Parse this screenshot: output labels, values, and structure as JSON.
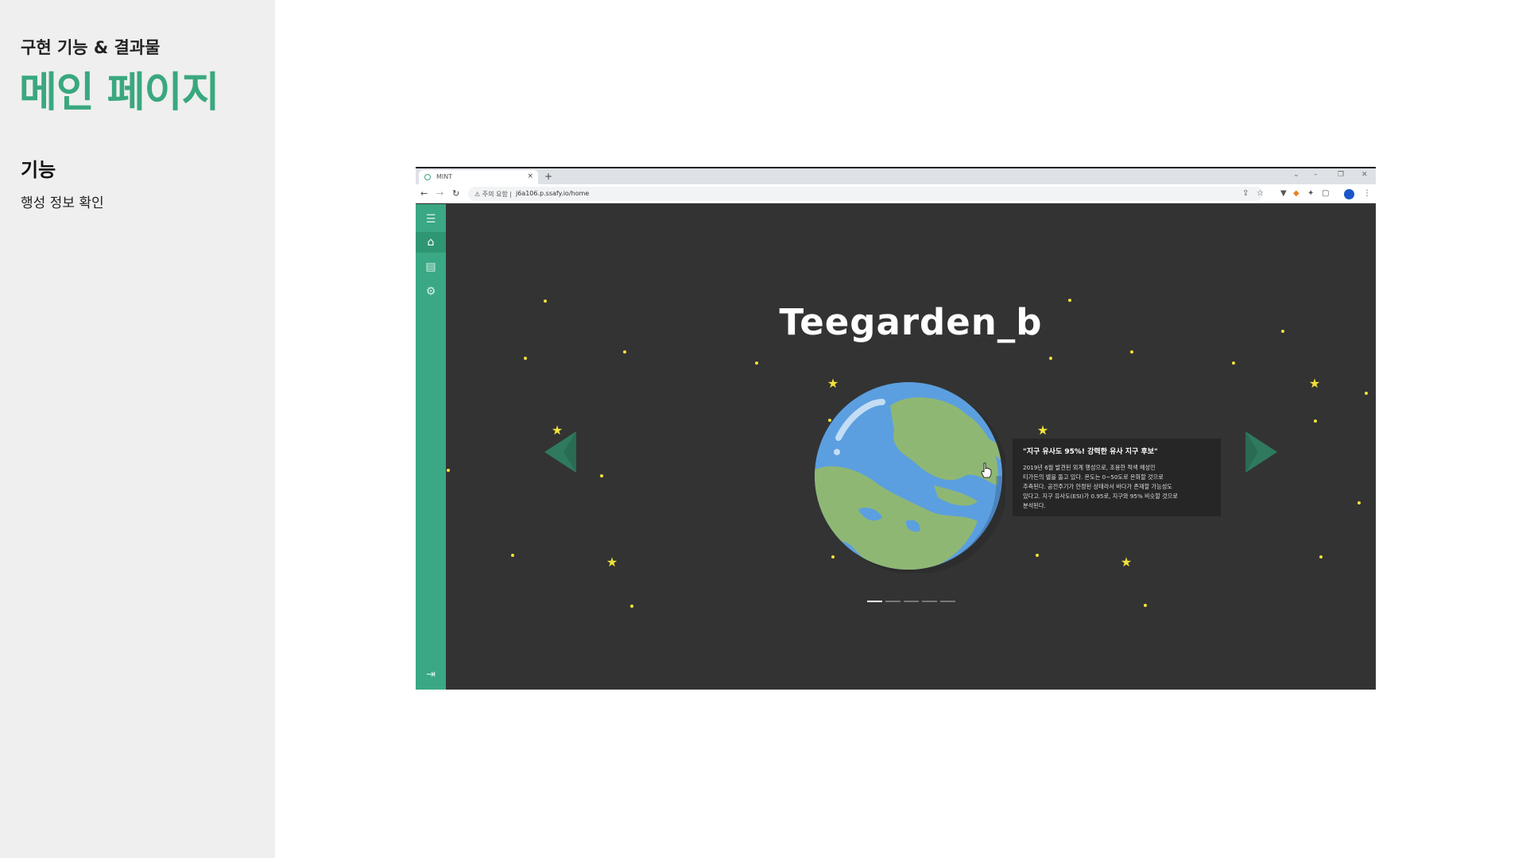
{
  "slide": {
    "subtitle": "구현 기능 & 결과물",
    "title": "메인 페이지",
    "feature_heading": "기능",
    "feature_desc": "행성 정보 확인"
  },
  "browser": {
    "tab_title": "MINT",
    "tab_close": "×",
    "new_tab": "+",
    "security_warning": "주의 요함",
    "url": "j6a106.p.ssafy.io/home",
    "controls": {
      "collapse": "⌄",
      "minimize": "–",
      "restore": "❐",
      "close": "✕"
    }
  },
  "sidebar": {
    "icons": [
      "menu-icon",
      "home-icon",
      "document-icon",
      "gear-icon",
      "logout-icon"
    ],
    "active": "home"
  },
  "planet": {
    "name": "Teegarden_b",
    "info_title": "\"지구 유사도 95%! 강력한 유사 지구 후보\"",
    "info_lines": [
      "2019년 6월 발견된 외계 행성으로, 조용한 적색 왜성인",
      "티가든의 별을 돌고 있다. 온도는 0~50도로 온화할 것으로",
      "추측된다. 공전주기가 안정된 상태라서 바다가 존재할 가능성도",
      "있다고. 지구 유사도(ESI)가 0.95로, 지구와 95% 비슷할 것으로",
      "분석된다."
    ],
    "carousel_total": 5,
    "carousel_active": 1
  },
  "colors": {
    "accent_green": "#3aa87f",
    "sidebar_green": "#3aa884",
    "app_bg": "#333333",
    "star_yellow": "#f2e23a",
    "ocean_blue": "#5b9fe0",
    "land_green": "#8fb774"
  }
}
